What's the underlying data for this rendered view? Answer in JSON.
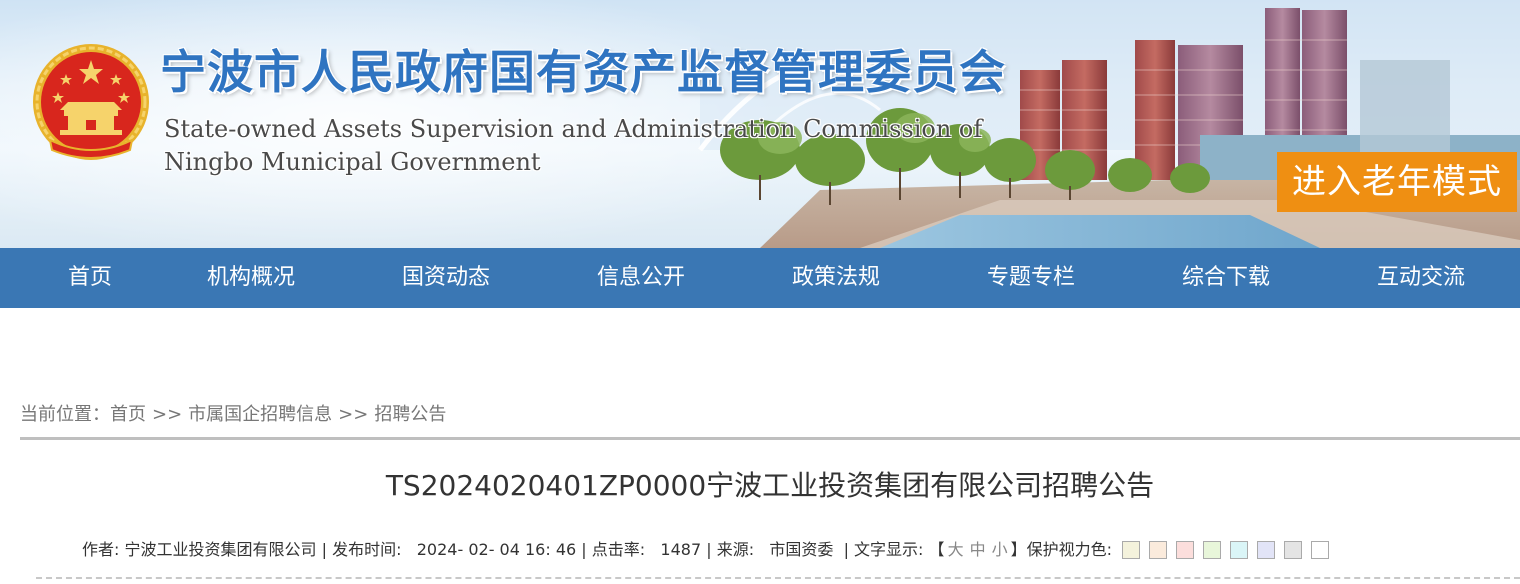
{
  "header": {
    "title_cn": "宁波市人民政府国有资产监督管理委员会",
    "title_en_line1": "State-owned Assets Supervision and Administration Commission of",
    "title_en_line2": "Ningbo Municipal Government",
    "elder_mode_label": "进入老年模式"
  },
  "nav": {
    "items": [
      {
        "label": "首页"
      },
      {
        "label": "机构概况"
      },
      {
        "label": "国资动态"
      },
      {
        "label": "信息公开"
      },
      {
        "label": "政策法规"
      },
      {
        "label": "专题专栏"
      },
      {
        "label": "综合下载"
      },
      {
        "label": "互动交流"
      }
    ]
  },
  "breadcrumb": {
    "prefix": "当前位置：",
    "items": [
      "首页",
      "市属国企招聘信息",
      "招聘公告"
    ],
    "separator": ">>"
  },
  "article": {
    "title": "TS2024020401ZP0000宁波工业投资集团有限公司招聘公告",
    "meta": {
      "author_label": "作者:",
      "author": "宁波工业投资集团有限公司",
      "publish_label": "发布时间:",
      "publish_time": "2024- 02- 04 16: 46",
      "clicks_label": "点击率:",
      "clicks": "1487",
      "source_label": "来源:",
      "source": "市国资委",
      "font_label": "文字显示:",
      "font_big": "大",
      "font_mid": "中",
      "font_small": "小",
      "eye_label": "保护视力色:"
    }
  },
  "colors": {
    "nav_bg": "#3a77b4",
    "elder_btn_bg": "#ef8f12",
    "title_blue": "#2f74c1",
    "swatches": [
      "#f4f2dc",
      "#fbebdc",
      "#fcdedc",
      "#e8f6da",
      "#daf5f7",
      "#e2e4f7",
      "#e4e4e4",
      "#ffffff"
    ]
  }
}
